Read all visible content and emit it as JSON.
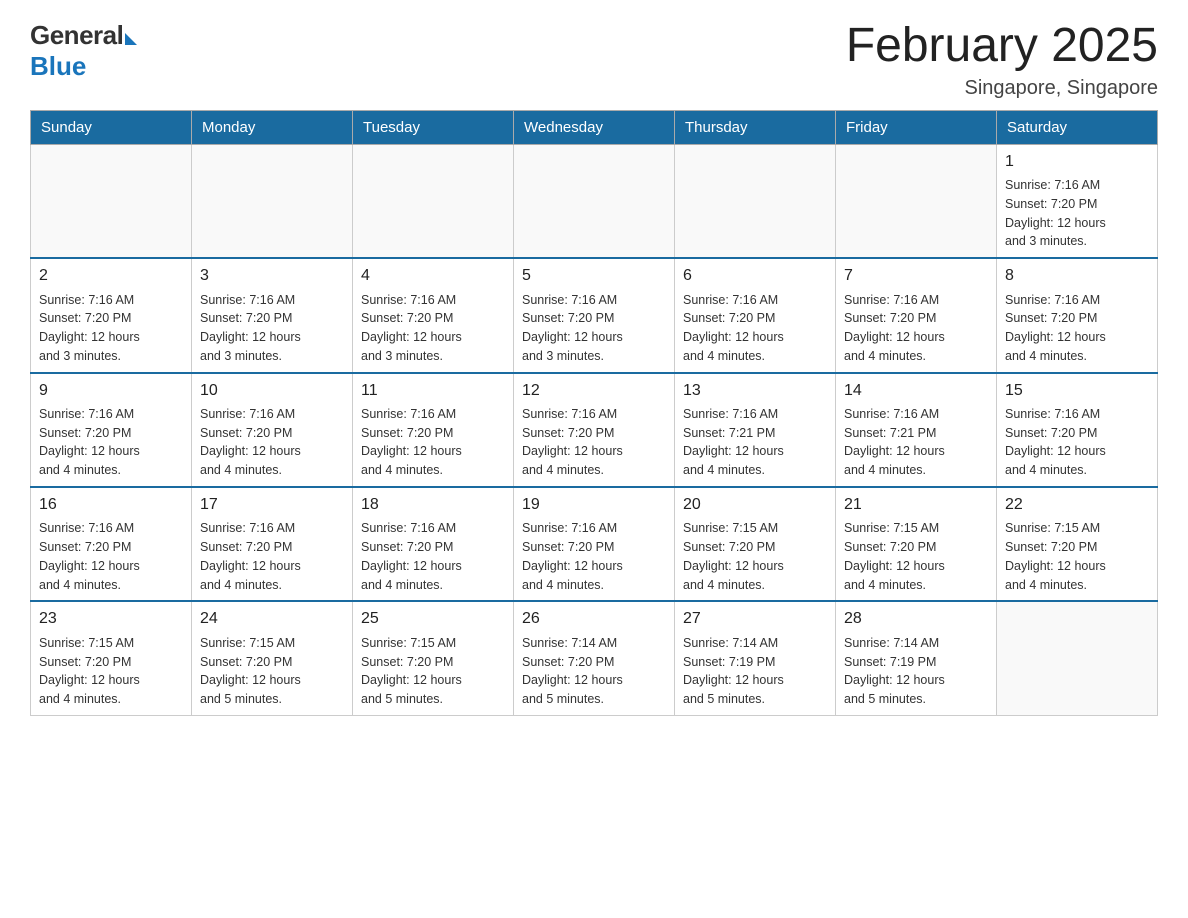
{
  "header": {
    "logo": {
      "general": "General",
      "blue": "Blue"
    },
    "title": "February 2025",
    "subtitle": "Singapore, Singapore"
  },
  "days_of_week": [
    "Sunday",
    "Monday",
    "Tuesday",
    "Wednesday",
    "Thursday",
    "Friday",
    "Saturday"
  ],
  "weeks": [
    {
      "days": [
        {
          "date": "",
          "info": ""
        },
        {
          "date": "",
          "info": ""
        },
        {
          "date": "",
          "info": ""
        },
        {
          "date": "",
          "info": ""
        },
        {
          "date": "",
          "info": ""
        },
        {
          "date": "",
          "info": ""
        },
        {
          "date": "1",
          "info": "Sunrise: 7:16 AM\nSunset: 7:20 PM\nDaylight: 12 hours\nand 3 minutes."
        }
      ]
    },
    {
      "days": [
        {
          "date": "2",
          "info": "Sunrise: 7:16 AM\nSunset: 7:20 PM\nDaylight: 12 hours\nand 3 minutes."
        },
        {
          "date": "3",
          "info": "Sunrise: 7:16 AM\nSunset: 7:20 PM\nDaylight: 12 hours\nand 3 minutes."
        },
        {
          "date": "4",
          "info": "Sunrise: 7:16 AM\nSunset: 7:20 PM\nDaylight: 12 hours\nand 3 minutes."
        },
        {
          "date": "5",
          "info": "Sunrise: 7:16 AM\nSunset: 7:20 PM\nDaylight: 12 hours\nand 3 minutes."
        },
        {
          "date": "6",
          "info": "Sunrise: 7:16 AM\nSunset: 7:20 PM\nDaylight: 12 hours\nand 4 minutes."
        },
        {
          "date": "7",
          "info": "Sunrise: 7:16 AM\nSunset: 7:20 PM\nDaylight: 12 hours\nand 4 minutes."
        },
        {
          "date": "8",
          "info": "Sunrise: 7:16 AM\nSunset: 7:20 PM\nDaylight: 12 hours\nand 4 minutes."
        }
      ]
    },
    {
      "days": [
        {
          "date": "9",
          "info": "Sunrise: 7:16 AM\nSunset: 7:20 PM\nDaylight: 12 hours\nand 4 minutes."
        },
        {
          "date": "10",
          "info": "Sunrise: 7:16 AM\nSunset: 7:20 PM\nDaylight: 12 hours\nand 4 minutes."
        },
        {
          "date": "11",
          "info": "Sunrise: 7:16 AM\nSunset: 7:20 PM\nDaylight: 12 hours\nand 4 minutes."
        },
        {
          "date": "12",
          "info": "Sunrise: 7:16 AM\nSunset: 7:20 PM\nDaylight: 12 hours\nand 4 minutes."
        },
        {
          "date": "13",
          "info": "Sunrise: 7:16 AM\nSunset: 7:21 PM\nDaylight: 12 hours\nand 4 minutes."
        },
        {
          "date": "14",
          "info": "Sunrise: 7:16 AM\nSunset: 7:21 PM\nDaylight: 12 hours\nand 4 minutes."
        },
        {
          "date": "15",
          "info": "Sunrise: 7:16 AM\nSunset: 7:20 PM\nDaylight: 12 hours\nand 4 minutes."
        }
      ]
    },
    {
      "days": [
        {
          "date": "16",
          "info": "Sunrise: 7:16 AM\nSunset: 7:20 PM\nDaylight: 12 hours\nand 4 minutes."
        },
        {
          "date": "17",
          "info": "Sunrise: 7:16 AM\nSunset: 7:20 PM\nDaylight: 12 hours\nand 4 minutes."
        },
        {
          "date": "18",
          "info": "Sunrise: 7:16 AM\nSunset: 7:20 PM\nDaylight: 12 hours\nand 4 minutes."
        },
        {
          "date": "19",
          "info": "Sunrise: 7:16 AM\nSunset: 7:20 PM\nDaylight: 12 hours\nand 4 minutes."
        },
        {
          "date": "20",
          "info": "Sunrise: 7:15 AM\nSunset: 7:20 PM\nDaylight: 12 hours\nand 4 minutes."
        },
        {
          "date": "21",
          "info": "Sunrise: 7:15 AM\nSunset: 7:20 PM\nDaylight: 12 hours\nand 4 minutes."
        },
        {
          "date": "22",
          "info": "Sunrise: 7:15 AM\nSunset: 7:20 PM\nDaylight: 12 hours\nand 4 minutes."
        }
      ]
    },
    {
      "days": [
        {
          "date": "23",
          "info": "Sunrise: 7:15 AM\nSunset: 7:20 PM\nDaylight: 12 hours\nand 4 minutes."
        },
        {
          "date": "24",
          "info": "Sunrise: 7:15 AM\nSunset: 7:20 PM\nDaylight: 12 hours\nand 5 minutes."
        },
        {
          "date": "25",
          "info": "Sunrise: 7:15 AM\nSunset: 7:20 PM\nDaylight: 12 hours\nand 5 minutes."
        },
        {
          "date": "26",
          "info": "Sunrise: 7:14 AM\nSunset: 7:20 PM\nDaylight: 12 hours\nand 5 minutes."
        },
        {
          "date": "27",
          "info": "Sunrise: 7:14 AM\nSunset: 7:19 PM\nDaylight: 12 hours\nand 5 minutes."
        },
        {
          "date": "28",
          "info": "Sunrise: 7:14 AM\nSunset: 7:19 PM\nDaylight: 12 hours\nand 5 minutes."
        },
        {
          "date": "",
          "info": ""
        }
      ]
    }
  ]
}
